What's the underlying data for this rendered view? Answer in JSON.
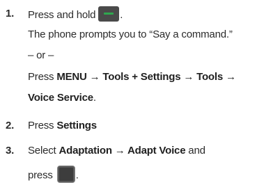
{
  "steps": [
    {
      "number": "1.",
      "press_and_hold": "Press and hold",
      "after_key": ".",
      "prompt": "The phone prompts you to “Say a command.”",
      "or": "– or –",
      "path_press": "Press ",
      "path_bold_1": "MENU → Tools + Settings → Tools →",
      "path_bold_2": "Voice Service",
      "path_end": "."
    },
    {
      "number": "2.",
      "press": "Press ",
      "bold": "Settings"
    },
    {
      "number": "3.",
      "select": "Select ",
      "bold": "Adaptation → Adapt Voice",
      "and": " and",
      "press": "press",
      "after_key": "."
    }
  ],
  "icons": {
    "talk_key": "talk-key-icon",
    "select_key": "select-key-icon",
    "talk_key_accent": "#2fa84f",
    "key_color": "#4a4a4a"
  }
}
